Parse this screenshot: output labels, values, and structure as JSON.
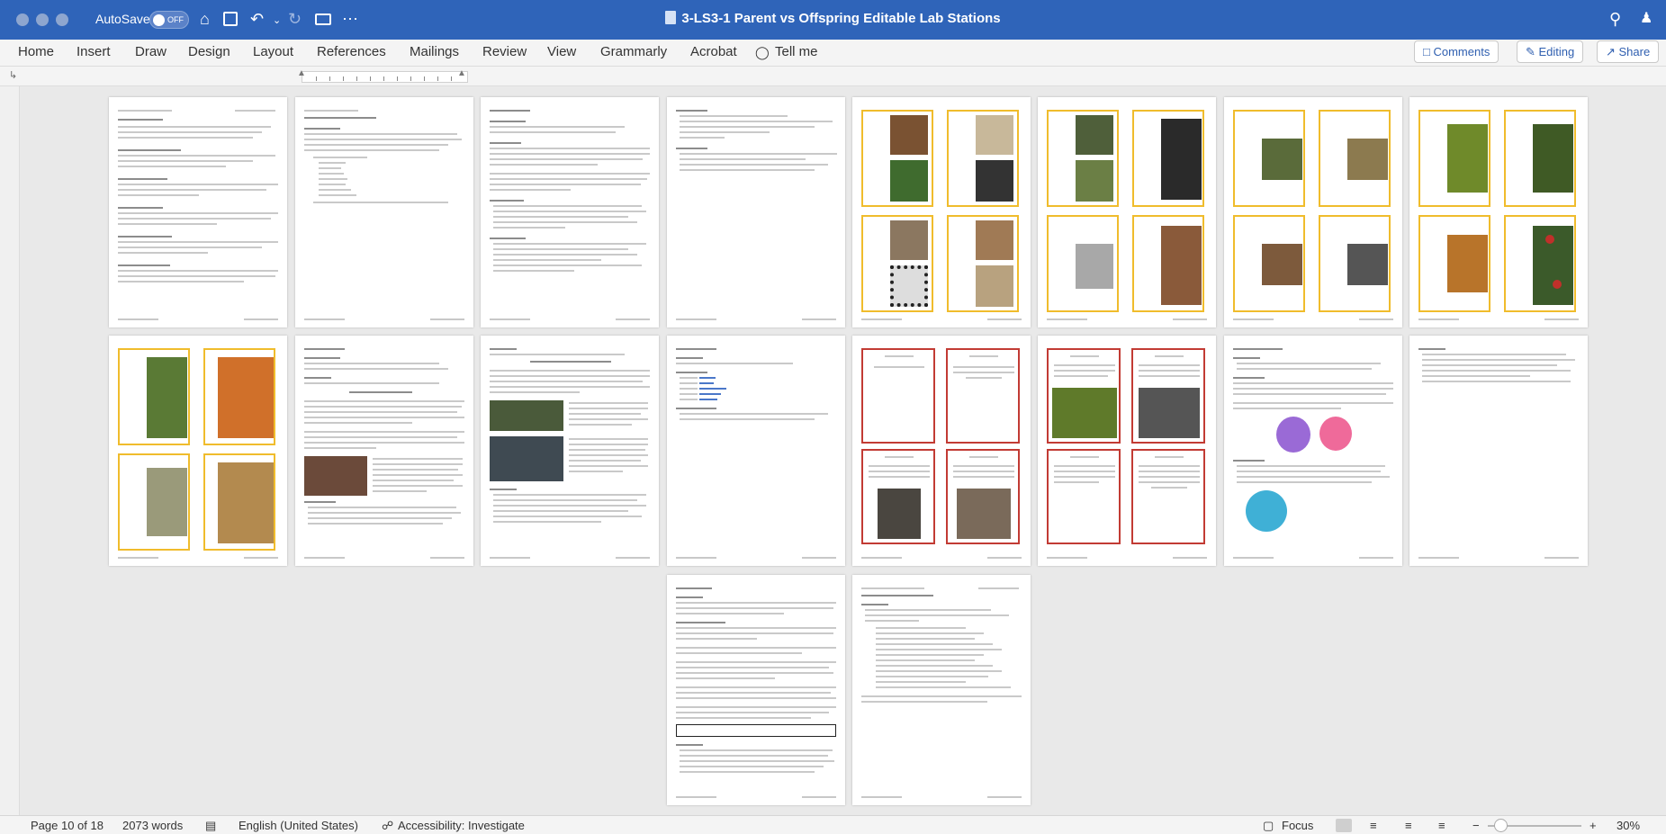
{
  "titlebar": {
    "autosave_label": "AutoSave",
    "autosave_state": "OFF",
    "document_title": "3-LS3-1 Parent vs Offspring Editable Lab Stations",
    "icons": [
      "home-icon",
      "save-icon",
      "undo-icon",
      "redo-icon",
      "print-icon",
      "more-icon",
      "search-icon",
      "share-person-icon"
    ]
  },
  "ribbon": {
    "tabs": [
      "Home",
      "Insert",
      "Draw",
      "Design",
      "Layout",
      "References",
      "Mailings",
      "Review",
      "View",
      "Grammarly",
      "Acrobat"
    ],
    "tell_me": "Tell me",
    "comments": "Comments",
    "editing": "Editing",
    "share": "Share"
  },
  "pages": {
    "count_shown": 18,
    "kinds": [
      "text",
      "text",
      "text",
      "text",
      "animal-cards",
      "animal-cards",
      "animal-cards",
      "animal-cards",
      "animal-cards",
      "reading",
      "reading",
      "links",
      "question-cards",
      "question-cards",
      "monster-activity",
      "text",
      "feedback-form",
      "answer-sheet"
    ]
  },
  "statusbar": {
    "page": "Page 10 of 18",
    "words": "2073 words",
    "language": "English (United States)",
    "accessibility": "Accessibility: Investigate",
    "focus": "Focus",
    "zoom": "30%"
  },
  "colors": {
    "titlebar": "#2f64b9",
    "ribbon_accent": "#2f5fb0",
    "card_border_yellow": "#f0bc2c",
    "card_border_red": "#c23b34"
  }
}
